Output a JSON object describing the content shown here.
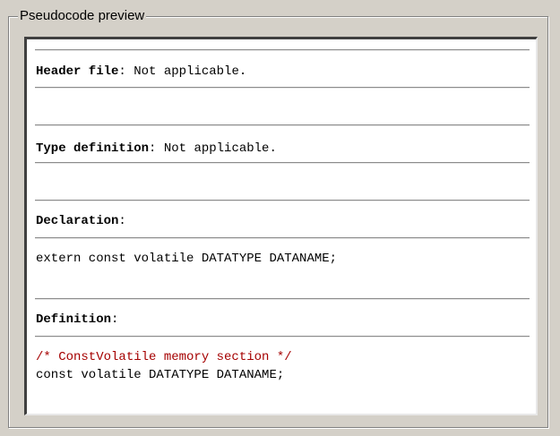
{
  "group": {
    "title": "Pseudocode preview"
  },
  "sections": {
    "header": {
      "label": "Header file",
      "separator": ":",
      "value": " Not applicable."
    },
    "type_definition": {
      "label": "Type definition",
      "separator": ":",
      "value": " Not applicable."
    },
    "declaration": {
      "label": "Declaration",
      "separator": ":",
      "code": "extern const volatile DATATYPE DATANAME;"
    },
    "definition": {
      "label": "Definition",
      "separator": ":",
      "comment": "/* ConstVolatile memory section */",
      "code": "const volatile DATATYPE DATANAME;"
    }
  },
  "colors": {
    "background": "#d4d0c8",
    "panel": "#ffffff",
    "comment": "#a50000"
  }
}
